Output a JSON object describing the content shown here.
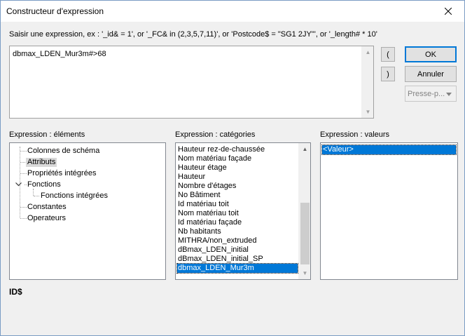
{
  "window": {
    "title": "Constructeur d'expression"
  },
  "instruction": "Saisir une expression, ex : '_id& = 1', or '_FC& in (2,3,5,7,11)', or 'Postcode$ = \"SG1 2JY\"', or '_length# * 10'",
  "expression": {
    "value": "dbmax_LDEN_Mur3m#>68"
  },
  "buttons": {
    "paren_open": "(",
    "paren_close": ")",
    "ok": "OK",
    "cancel": "Annuler",
    "paste": "Presse-p..."
  },
  "elements": {
    "label": "Expression : éléments",
    "items": [
      {
        "label": "Colonnes de schéma"
      },
      {
        "label": "Attributs"
      },
      {
        "label": "Propriétés intégrées"
      },
      {
        "label": "Fonctions"
      },
      {
        "label": "Fonctions intégrées"
      },
      {
        "label": "Constantes"
      },
      {
        "label": "Operateurs"
      }
    ]
  },
  "categories": {
    "label": "Expression : catégories",
    "items": [
      "Hauteur rez-de-chaussée",
      "Nom matériau façade",
      "Hauteur étage",
      "Hauteur",
      "Nombre d'étages",
      "No Bâtiment",
      "Id matériau toit",
      "Nom matériau toit",
      "Id matériau façade",
      "Nb habitants",
      "MITHRA/non_extruded",
      "dBmax_LDEN_initial",
      "dBmax_LDEN_initial_SP",
      "dbmax_LDEN_Mur3m"
    ],
    "selected": "dbmax_LDEN_Mur3m"
  },
  "values": {
    "label": "Expression : valeurs",
    "items": [
      "<Valeur>"
    ]
  },
  "status": "ID$",
  "icons": {
    "close": "close-icon",
    "expand": "chevron-down-icon",
    "dropdown": "dropdown-arrow-icon",
    "scroll_up": "scroll-up-arrow-icon",
    "scroll_down": "scroll-down-arrow-icon"
  }
}
